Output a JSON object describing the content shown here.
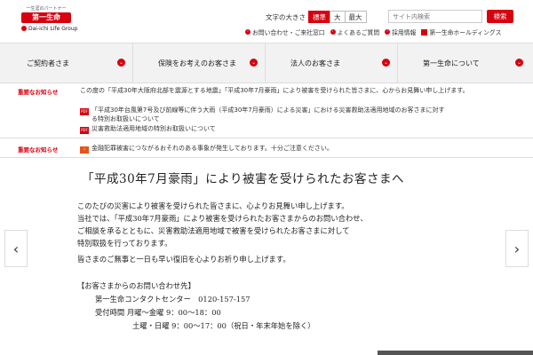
{
  "header": {
    "logo": {
      "tagline": "一生涯のパートナー",
      "mark": "第一生命",
      "group": "Dai-ichi Life Group"
    },
    "font_size": {
      "label": "文字の大きさ",
      "options": [
        "標準",
        "大",
        "最大"
      ],
      "selected": "標準"
    },
    "search": {
      "placeholder": "サイト内検索",
      "button": "検索"
    },
    "util_links": [
      "お問い合わせ・ご来社窓口",
      "よくあるご質問",
      "採用情報",
      "第一生命ホールディングス"
    ]
  },
  "nav": {
    "items": [
      "ご契約者さま",
      "保険をお考えのお客さま",
      "法人のお客さま",
      "第一生命について"
    ]
  },
  "notices": {
    "label": "重要なお知らせ",
    "first_text": "この度の「平成30年大阪府北部を震源とする地震」「平成30年7月豪雨」により被害を受けられた皆さまに、心からお見舞い申し上げます。",
    "links": [
      "「平成30年台風第7号及び前線等に伴う大雨（平成30年7月豪雨）による災害」における災害救助法適用地域のお客さまに対す",
      "る特別お取扱いについて",
      "災害救助法適用地域の特別お取扱いについて"
    ],
    "second_text": "金融犯罪被害につながるおそれのある事象が発生しております。十分ご注意ください。"
  },
  "main": {
    "title": "「平成30年7月豪雨」により被害を受けられたお客さまへ",
    "paragraphs": [
      "このたびの災害により被害を受けられた皆さまに、心よりお見舞い申し上げます。",
      "当社では、「平成30年7月豪雨」により被害を受けられたお客さまからのお問い合わせ、",
      "ご相談を承るとともに、災害救助法適用地域で被害を受けられたお客さまに対して",
      "特別取扱を行っております。",
      "皆さまのご無事と一日も早い復旧を心よりお祈り申し上げます。"
    ],
    "contact_heading": "【お客さまからのお問い合わせ先】",
    "contact_center": "第一生命コンタクトセンター　0120-157-157",
    "hours_weekday": "受付時間 月曜～金曜 9：00～18：00",
    "hours_weekend": "土曜・日曜 9：00～17：00（祝日・年末年始を除く）"
  },
  "carousel": {
    "prev": "‹",
    "next": "›"
  },
  "colors": {
    "brand": "#d7000f",
    "nav_bg": "#f2f2f2"
  }
}
